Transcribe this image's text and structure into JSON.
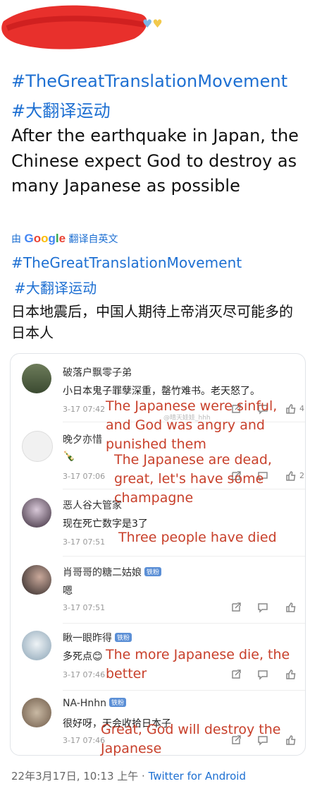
{
  "tweet": {
    "hashtag_en": "#TheGreatTranslationMovement",
    "hashtag_zh": "#大翻译运动",
    "text_en": "After the earthquake in Japan, the Chinese expect God to destroy as many Japanese as possible",
    "translated_prefix": "由",
    "translated_provider": "Google",
    "translated_suffix": "翻译自英文",
    "translated_hashtag_en": "#TheGreatTranslationMovement",
    "translated_hashtag_zh": "#大翻译运动",
    "text_zh": "日本地震后，中国人期待上帝消灭尽可能多的日本人"
  },
  "comments": [
    {
      "user": "破落户飘零子弟",
      "badge": "",
      "text": "小日本鬼子罪孽深重，罄竹难书。老天怒了。",
      "time": "3-17 07:42",
      "likes": "4"
    },
    {
      "user": "晚夕亦惜",
      "badge": "",
      "text": "🍾",
      "time": "3-17 07:06",
      "likes": "2"
    },
    {
      "user": "恶人谷大管家",
      "badge": "",
      "text": "现在死亡数字是3了",
      "time": "3-17 07:51",
      "likes": ""
    },
    {
      "user": "肖哥哥的糖二姑娘",
      "badge": "铁粉",
      "text": "嗯",
      "time": "3-17 07:51",
      "likes": ""
    },
    {
      "user": "瞅一眼昨得",
      "badge": "铁粉",
      "text": "多死点😊",
      "time": "3-17 07:46",
      "likes": ""
    },
    {
      "user": "NA-Hnhn",
      "badge": "铁粉",
      "text": "很好呀，天会收拾日本子",
      "time": "3-17 07:46",
      "likes": ""
    }
  ],
  "watermark": "@晴天娃娃_hhh",
  "overlays": [
    "The Japanese were sinful, and God was angry and punished them",
    "The Japanese are dead, great, let's have some champagne",
    "Three people have died",
    "The more Japanese die, the better",
    "Great, God will destroy the Japanese"
  ],
  "footer": {
    "timestamp": "22年3月17日, 10:13 上午",
    "separator": " · ",
    "source": "Twitter for Android"
  },
  "colors": {
    "link": "#1d6fd2",
    "overlay_text": "#c8402b",
    "redaction": "#e8302c"
  }
}
